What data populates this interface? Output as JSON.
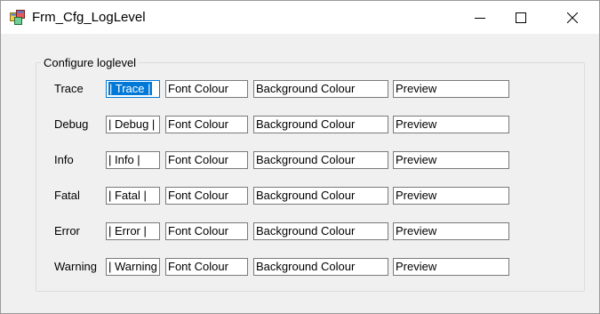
{
  "window": {
    "title": "Frm_Cfg_LogLevel",
    "controls": [
      "minimize-icon",
      "maximize-icon",
      "close-icon"
    ]
  },
  "group": {
    "legend": "Configure loglevel"
  },
  "rows": [
    {
      "name": "Trace",
      "level_text": "| Trace |",
      "font_text": "Font Colour",
      "bg_text": "Background Colour",
      "preview_text": "Preview"
    },
    {
      "name": "Debug",
      "level_text": "| Debug |",
      "font_text": "Font Colour",
      "bg_text": "Background Colour",
      "preview_text": "Preview"
    },
    {
      "name": "Info",
      "level_text": "| Info |",
      "font_text": "Font Colour",
      "bg_text": "Background Colour",
      "preview_text": "Preview"
    },
    {
      "name": "Fatal",
      "level_text": "| Fatal |",
      "font_text": "Font Colour",
      "bg_text": "Background Colour",
      "preview_text": "Preview"
    },
    {
      "name": "Error",
      "level_text": "| Error |",
      "font_text": "Font Colour",
      "bg_text": "Background Colour",
      "preview_text": "Preview"
    },
    {
      "name": "Warning",
      "level_text": "| Warning |",
      "font_text": "Font Colour",
      "bg_text": "Background Colour",
      "preview_text": "Preview"
    }
  ],
  "colors": {
    "accent": "#0078d7",
    "window_bg": "#f0f0f0",
    "titlebar_bg": "#ffffff"
  }
}
